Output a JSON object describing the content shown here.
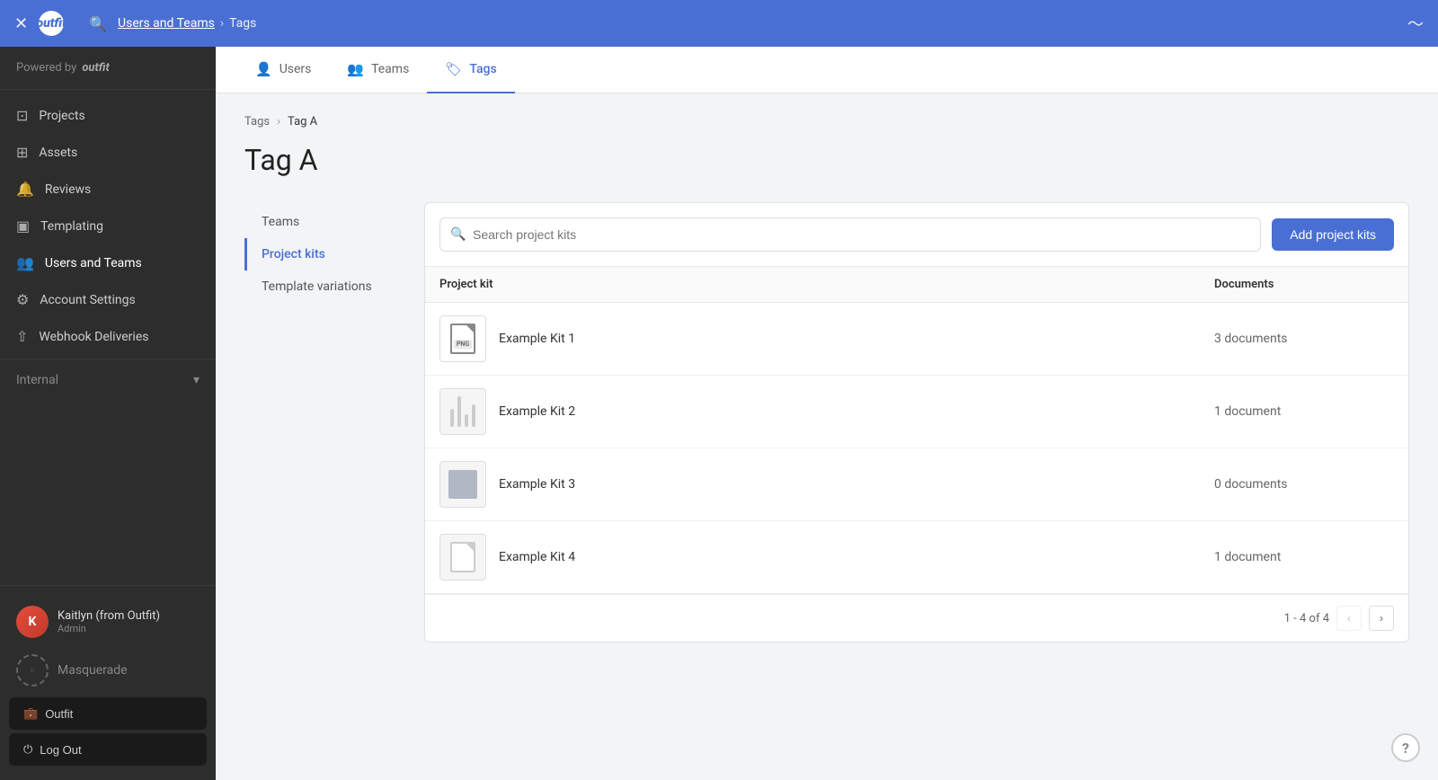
{
  "header": {
    "close_label": "✕",
    "logo_text": "outfit",
    "breadcrumb": {
      "link_text": "Users and Teams",
      "separator": "›",
      "current": "Tags"
    },
    "trend_icon": "〜"
  },
  "sidebar": {
    "powered_by": "Powered by",
    "powered_brand": "outfit",
    "nav_items": [
      {
        "id": "projects",
        "label": "Projects",
        "icon": "⊡"
      },
      {
        "id": "assets",
        "label": "Assets",
        "icon": "⊞"
      },
      {
        "id": "reviews",
        "label": "Reviews",
        "icon": "⊙"
      },
      {
        "id": "templating",
        "label": "Templating",
        "icon": "▣"
      },
      {
        "id": "users-and-teams",
        "label": "Users and Teams",
        "icon": "👥"
      },
      {
        "id": "account-settings",
        "label": "Account Settings",
        "icon": "⚙"
      },
      {
        "id": "webhook-deliveries",
        "label": "Webhook Deliveries",
        "icon": "⇧"
      }
    ],
    "internal_label": "Internal",
    "user": {
      "name": "Kaitlyn (from Outfit)",
      "role": "Admin",
      "initials": "K"
    },
    "masquerade_label": "Masquerade",
    "outfit_button": "Outfit",
    "logout_button": "Log Out"
  },
  "tabs": [
    {
      "id": "users",
      "label": "Users",
      "icon": "👤"
    },
    {
      "id": "teams",
      "label": "Teams",
      "icon": "👥"
    },
    {
      "id": "tags",
      "label": "Tags",
      "icon": "🏷",
      "active": true
    }
  ],
  "page": {
    "breadcrumb_link": "Tags",
    "breadcrumb_sep": "›",
    "breadcrumb_current": "Tag A",
    "title": "Tag A",
    "sidebar_items": [
      {
        "id": "teams",
        "label": "Teams"
      },
      {
        "id": "project-kits",
        "label": "Project kits",
        "active": true
      },
      {
        "id": "template-variations",
        "label": "Template variations"
      }
    ],
    "search_placeholder": "Search project kits",
    "add_button_label": "Add project kits",
    "table": {
      "col_kit": "Project kit",
      "col_docs": "Documents",
      "rows": [
        {
          "id": "kit1",
          "name": "Example Kit 1",
          "docs": "3 documents",
          "thumb_type": "png"
        },
        {
          "id": "kit2",
          "name": "Example Kit 2",
          "docs": "1 document",
          "thumb_type": "lines"
        },
        {
          "id": "kit3",
          "name": "Example Kit 3",
          "docs": "0 documents",
          "thumb_type": "square"
        },
        {
          "id": "kit4",
          "name": "Example Kit 4",
          "docs": "1 document",
          "thumb_type": "doc"
        }
      ]
    },
    "pagination": {
      "info": "1 - 4 of 4",
      "prev_disabled": true,
      "next_disabled": false
    }
  },
  "colors": {
    "accent": "#4a6fd4",
    "header_bg": "#4a6fd4",
    "sidebar_bg": "#2d2d2d"
  }
}
